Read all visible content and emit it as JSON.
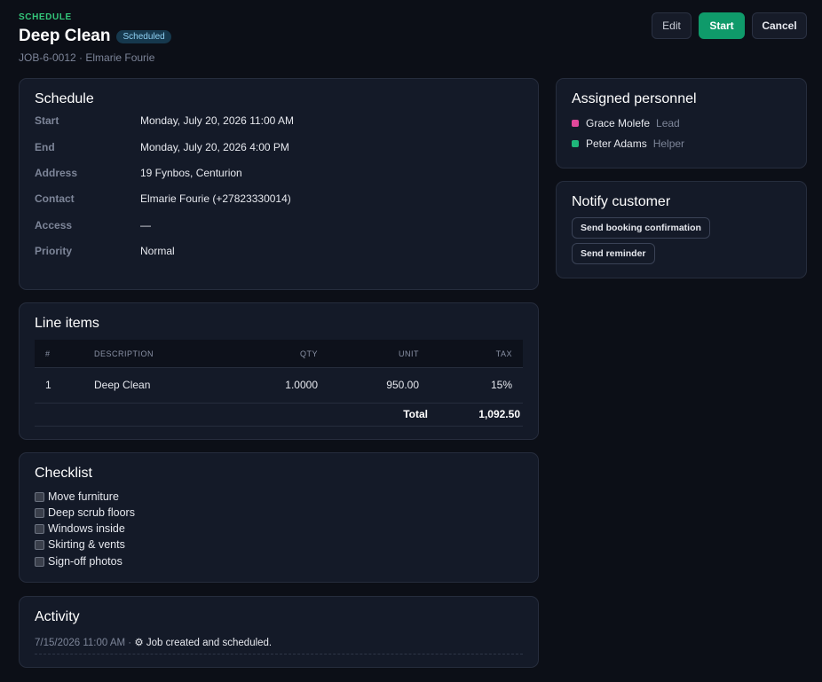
{
  "header": {
    "eyebrow": "SCHEDULE",
    "title": "Deep Clean",
    "badge": "Scheduled",
    "subtitle": "JOB-6-0012 · Elmarie Fourie"
  },
  "actions": {
    "edit": "Edit",
    "start": "Start",
    "cancel": "Cancel"
  },
  "schedule": {
    "title": "Schedule",
    "fields": [
      {
        "key": "Start",
        "value": "Monday, July 20, 2026 11:00 AM"
      },
      {
        "key": "End",
        "value": "Monday, July 20, 2026 4:00 PM"
      },
      {
        "key": "Address",
        "value": "19 Fynbos, Centurion"
      },
      {
        "key": "Contact",
        "value": "Elmarie Fourie (+27823330014)"
      },
      {
        "key": "Access",
        "value": "—"
      },
      {
        "key": "Priority",
        "value": "Normal"
      }
    ]
  },
  "line_items": {
    "title": "Line items",
    "columns": [
      "#",
      "DESCRIPTION",
      "QTY",
      "UNIT",
      "TAX"
    ],
    "rows": [
      {
        "num": "1",
        "description": "Deep Clean",
        "qty": "1.0000",
        "unit": "950.00",
        "tax": "15%"
      }
    ],
    "total_label": "Total",
    "total_value": "1,092.50"
  },
  "checklist": {
    "title": "Checklist",
    "items": [
      "Move furniture",
      "Deep scrub floors",
      "Windows inside",
      "Skirting & vents",
      "Sign-off photos"
    ]
  },
  "activity": {
    "title": "Activity",
    "entries": [
      {
        "time": "7/15/2026 11:00 AM",
        "separator": " · ",
        "icon": "⚙",
        "text": " Job created and scheduled."
      }
    ]
  },
  "personnel": {
    "title": "Assigned personnel",
    "people": [
      {
        "name": "Grace Molefe",
        "role": "Lead",
        "color": "#e0489a"
      },
      {
        "name": "Peter Adams",
        "role": "Helper",
        "color": "#1fb67a"
      }
    ]
  },
  "notify": {
    "title": "Notify customer",
    "confirm_label": "Send booking confirmation",
    "reminder_label": "Send reminder"
  }
}
